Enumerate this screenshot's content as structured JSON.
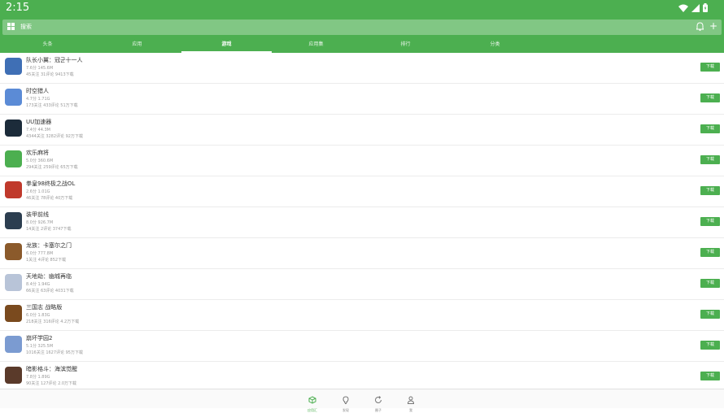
{
  "status": {
    "time": "2:15"
  },
  "search": {
    "placeholder": "搜索"
  },
  "tabs": [
    {
      "label": "头条"
    },
    {
      "label": "应用"
    },
    {
      "label": "游戏"
    },
    {
      "label": "应用集"
    },
    {
      "label": "排行"
    },
    {
      "label": "分类"
    }
  ],
  "active_tab": "游戏",
  "accent_color": "#4caf50",
  "apps": [
    {
      "title": "队长小翼：冠군十一人",
      "meta1": "7.6分 145.6M",
      "meta2": "45关注 31评论 9413下载",
      "icon_color": "#3f6fb5",
      "download": "下载"
    },
    {
      "title": "时空猎人",
      "meta1": "4.7分 1.71G",
      "meta2": "173关注 433评论 51万下载",
      "icon_color": "#5b8bd6",
      "download": "下载"
    },
    {
      "title": "UU加速器",
      "meta1": "7.4分 44.3M",
      "meta2": "4344关注 3282评论 92万下载",
      "icon_color": "#1c2b3a",
      "download": "下载"
    },
    {
      "title": "欢乐麻将",
      "meta1": "5.0分 360.6M",
      "meta2": "294关注 259评论 65万下载",
      "icon_color": "#4caf50",
      "download": "下载"
    },
    {
      "title": "拳皇98终极之战OL",
      "meta1": "2.6分 1.01G",
      "meta2": "46关注 78评论 40万下载",
      "icon_color": "#c0392b",
      "download": "下载"
    },
    {
      "title": "装甲前线",
      "meta1": "8.0分 926.7M",
      "meta2": "14关注 2评论 3747下载",
      "icon_color": "#2c3e50",
      "download": "下载"
    },
    {
      "title": "龙族：卡塞尔之门",
      "meta1": "6.0分 777.8M",
      "meta2": "1关注 4评论 852下载",
      "icon_color": "#8b5a2b",
      "download": "下载"
    },
    {
      "title": "天地劫：幽城再临",
      "meta1": "8.4分 1.94G",
      "meta2": "66关注 63评论 4031下载",
      "icon_color": "#b8c4d8",
      "download": "下载"
    },
    {
      "title": "三国志 战略版",
      "meta1": "6.0分 1.83G",
      "meta2": "218关注 316评论 4.2万下载",
      "icon_color": "#7a4a1e",
      "download": "下载"
    },
    {
      "title": "崩坏学园2",
      "meta1": "5.1分 325.5M",
      "meta2": "1016关注 1627评论 95万下载",
      "icon_color": "#7b9bd1",
      "download": "下载"
    },
    {
      "title": "暗影格斗：海滨觉醒",
      "meta1": "7.8分 1.89G",
      "meta2": "90关注 127评论 2.0万下载",
      "icon_color": "#5a3a2a",
      "download": "下载"
    }
  ],
  "bottom_nav": [
    {
      "label": "应用汇",
      "icon": "cube-icon"
    },
    {
      "label": "发现",
      "icon": "bulb-icon"
    },
    {
      "label": "圈子",
      "icon": "refresh-icon"
    },
    {
      "label": "我",
      "icon": "person-icon"
    }
  ]
}
